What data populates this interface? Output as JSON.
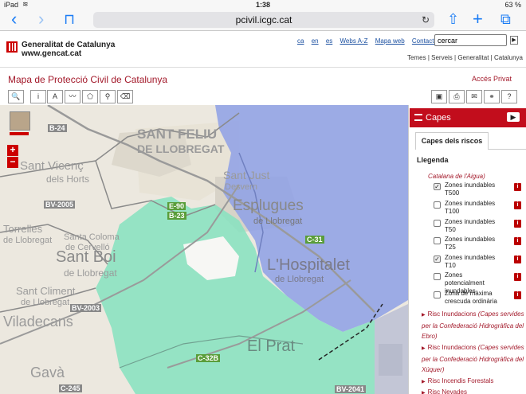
{
  "status_bar": {
    "device": "iPad",
    "wifi": "wifi-icon",
    "time": "1:38",
    "battery": "63 %"
  },
  "browser": {
    "url": "pcivil.icgc.cat",
    "back": "‹",
    "forward": "›",
    "icons": [
      "back-icon",
      "forward-icon",
      "bookmarks-icon",
      "reload-icon",
      "share-icon",
      "new-tab-icon",
      "tabs-icon"
    ]
  },
  "site_header": {
    "logo_line1": "Generalitat de Catalunya",
    "logo_line2": "www.gencat.cat",
    "top_links": [
      "ca",
      "en",
      "es",
      "Webs A-Z",
      "Mapa web",
      "Contacte"
    ],
    "search_value": "cercar",
    "sub_links": "Temes | Serveis | Generalitat | Catalunya"
  },
  "page": {
    "title": "Mapa de Protecció Civil de Catalunya",
    "access_link": "Accés Privat"
  },
  "map_toolbar": {
    "left": [
      {
        "name": "zoom-search-tool",
        "glyph": "🔍"
      },
      {
        "name": "info-tool",
        "glyph": "i"
      },
      {
        "name": "text-tool",
        "glyph": "A"
      },
      {
        "name": "line-measure-tool",
        "glyph": "〰"
      },
      {
        "name": "area-measure-tool",
        "glyph": "⬠"
      },
      {
        "name": "point-tool",
        "glyph": "⚲"
      },
      {
        "name": "eraser-tool",
        "glyph": "⌫"
      }
    ],
    "right": [
      {
        "name": "save-tool",
        "glyph": "▣"
      },
      {
        "name": "print-tool",
        "glyph": "⎙"
      },
      {
        "name": "email-tool",
        "glyph": "✉"
      },
      {
        "name": "link-tool",
        "glyph": "⚭"
      },
      {
        "name": "help-tool",
        "glyph": "?"
      }
    ]
  },
  "map": {
    "zoom_in": "+",
    "zoom_out": "−",
    "places": [
      {
        "text": "SANT FELIU",
        "size": 17
      },
      {
        "text": "DE LLOBREGAT",
        "size": 11
      },
      {
        "text": "Sant Vicenç",
        "size": 14
      },
      {
        "text": "dels Horts",
        "size": 11
      },
      {
        "text": "Sant Just",
        "size": 13
      },
      {
        "text": "Desvern",
        "size": 10
      },
      {
        "text": "Esplugues",
        "size": 17
      },
      {
        "text": "de Llobregat",
        "size": 10
      },
      {
        "text": "Santa Coloma",
        "size": 11
      },
      {
        "text": "de Cervelló",
        "size": 10
      },
      {
        "text": "Torrelles",
        "size": 12
      },
      {
        "text": "de Llobregat",
        "size": 10
      },
      {
        "text": "Sant Boi",
        "size": 19
      },
      {
        "text": "de Llobregat",
        "size": 12
      },
      {
        "text": "L'Hospitalet",
        "size": 19
      },
      {
        "text": "de Llobregat",
        "size": 11
      },
      {
        "text": "Sant Climent",
        "size": 12
      },
      {
        "text": "de Llobregat",
        "size": 10
      },
      {
        "text": "Viladecans",
        "size": 17
      },
      {
        "text": "El Prat",
        "size": 19
      },
      {
        "text": "Gavà",
        "size": 17
      }
    ],
    "roads": [
      "B-24",
      "BV-2005",
      "E-90",
      "B-23",
      "C-31",
      "BV-2003",
      "C-32B",
      "C-245",
      "BV-2041"
    ]
  },
  "layers_panel": {
    "header": "Capes",
    "tab": "Capes dels riscos",
    "legend": "Llegenda",
    "group_title": "Catalana de l'Aigua)",
    "items": [
      {
        "label": "Zones inundables T500",
        "checked": true
      },
      {
        "label": "Zones inundables T100",
        "checked": false
      },
      {
        "label": "Zones inundables T50",
        "checked": false
      },
      {
        "label": "Zones inundables T25",
        "checked": false
      },
      {
        "label": "Zones inundables T10",
        "checked": true
      },
      {
        "label": "Zones potencialment inundables",
        "checked": false
      },
      {
        "label": "Zona de màxima crescuda ordinària",
        "checked": false
      }
    ],
    "risks": [
      {
        "title": "Risc Inundacions",
        "detail": "(Capes servides per la Confederació Hidrogràfica del Ebro)"
      },
      {
        "title": "Risc Inundacions",
        "detail": "(Capes servides per la Confederació Hidrogràfica del Xúquer)"
      },
      {
        "title": "Risc Incendis Forestals",
        "detail": ""
      },
      {
        "title": "Risc Nevades",
        "detail": ""
      }
    ]
  },
  "colors": {
    "brand_red": "#c20d1c",
    "flood_t500": "#7ee0b8",
    "flood_t10": "#8fa3e8",
    "link_blue": "#1a4fa0"
  }
}
